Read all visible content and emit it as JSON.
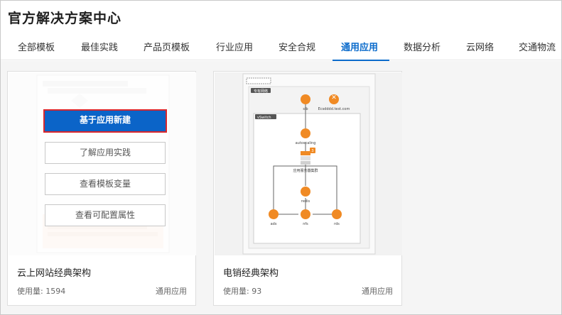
{
  "page": {
    "title": "官方解决方案中心"
  },
  "tabs": [
    {
      "label": "全部模板"
    },
    {
      "label": "最佳实践"
    },
    {
      "label": "产品页模板"
    },
    {
      "label": "行业应用"
    },
    {
      "label": "安全合规"
    },
    {
      "label": "通用应用",
      "active": true
    },
    {
      "label": "数据分析"
    },
    {
      "label": "云网络"
    },
    {
      "label": "交通物流"
    }
  ],
  "cards": [
    {
      "title": "云上网站经典架构",
      "usage": "使用量: 1594",
      "category": "通用应用",
      "actions": {
        "create": "基于应用新建",
        "practice": "了解应用实践",
        "variables": "查看模板变量",
        "properties": "查看可配置属性"
      }
    },
    {
      "title": "电销经典架构",
      "usage": "使用量: 93",
      "category": "通用应用",
      "diagram": {
        "group_label": "专有网络",
        "vswitch_label": "vSwitch",
        "nodes": {
          "slb": "slb",
          "domain": "Ecsdddd.test.com",
          "autoscaling": "autoscaling",
          "app_cluster": "应用服务器集群",
          "redis": "redis",
          "rds": "rds",
          "nfs": "nfs",
          "ads": "ads"
        },
        "badge": "3"
      }
    }
  ],
  "colors": {
    "accent": "#0b6bcb",
    "primary_button": "#0b64c8",
    "highlight_border": "#d9262c",
    "diagram_icon": "#f08a24"
  }
}
